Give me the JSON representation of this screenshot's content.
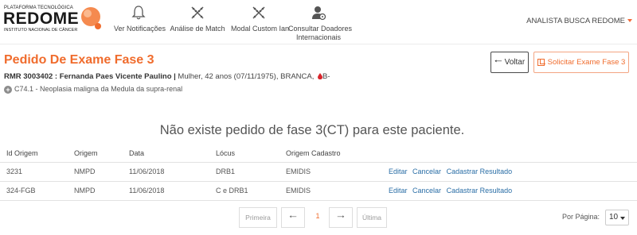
{
  "header": {
    "logo_platform": "PLATAFORMA TECNOLÓGICA",
    "logo_name": "REDOME",
    "logo_institute": "INSTITUTO NACIONAL DE CÂNCER",
    "nav": [
      {
        "label": "Ver Notificações",
        "icon": "bell-icon"
      },
      {
        "label": "Análise de Match",
        "icon": "dna-icon"
      },
      {
        "label": "Modal Custom Ian",
        "icon": "dna-icon"
      },
      {
        "label": "Consultar Doadores",
        "label2": "Internacionais",
        "icon": "user-gear-icon"
      }
    ],
    "user": "ANALISTA BUSCA REDOME"
  },
  "page": {
    "title": "Pedido De Exame Fase 3",
    "rmr": "RMR 3003402 : Fernanda Paes Vicente Paulino |",
    "patient_info": " Mulher, 42 anos (07/11/1975), BRANCA,",
    "blood_type": "B-",
    "diagnosis": "C74.1 - Neoplasia maligna da Medula da supra-renal",
    "back_label": "Voltar",
    "request_label": "Solicitar Exame Fase 3",
    "empty_message": "Não existe pedido de fase 3(CT) para este paciente."
  },
  "table": {
    "headers": [
      "Id Origem",
      "Origem",
      "Data",
      "Lócus",
      "Origem Cadastro"
    ],
    "rows": [
      {
        "id": "3231",
        "origem": "NMPD",
        "data": "11/06/2018",
        "locus": "DRB1",
        "cadastro": "EMIDIS"
      },
      {
        "id": "324-FGB",
        "origem": "NMPD",
        "data": "11/06/2018",
        "locus": "C e DRB1",
        "cadastro": "EMIDIS"
      }
    ],
    "actions": {
      "edit": "Editar",
      "cancel": "Cancelar",
      "register": "Cadastrar Resultado"
    }
  },
  "pagination": {
    "first": "Primeira",
    "last": "Última",
    "current_page": "1",
    "per_page_label": "Por Página:",
    "per_page_value": "10"
  },
  "colors": {
    "accent": "#f06c2d",
    "link": "#2a6ea6",
    "blood": "#d9262c"
  }
}
